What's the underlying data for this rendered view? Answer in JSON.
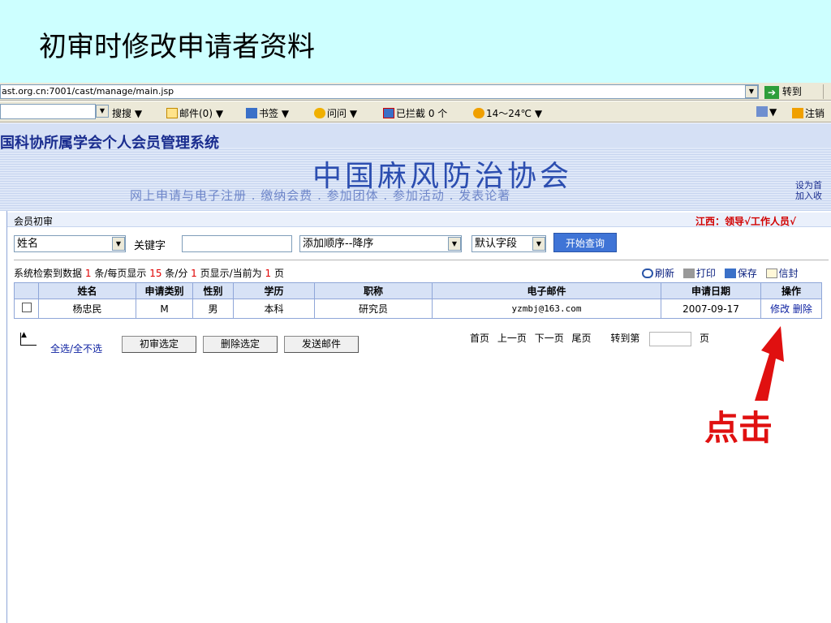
{
  "slide": {
    "title": "初审时修改申请者资料"
  },
  "browser": {
    "address": "ast.org.cn:7001/cast/manage/main.jsp",
    "go_label": "转到",
    "toolbar": {
      "search": "搜搜",
      "mail": "邮件(0)",
      "bookmarks": "书签",
      "ask": "问问",
      "blocked": "已拦截 0 个",
      "weather": "14～24℃",
      "logout": "注销"
    }
  },
  "header": {
    "system_title": "国科协所属学会个人会员管理系统",
    "org_name": "中国麻风防治协会",
    "slogan": "网上申请与电子注册 . 缴纳会费 . 参加团体 . 参加活动 . 发表论著",
    "set_home": "设为首",
    "add_fav": "加入收"
  },
  "section": {
    "title": "会员初审",
    "user_info": "江西：领导√工作人员√"
  },
  "filters": {
    "field": "姓名",
    "keyword_label": "关键字",
    "keyword_value": "",
    "order": "添加顺序--降序",
    "sort_field": "默认字段",
    "query_button": "开始查询"
  },
  "stats": {
    "prefix": "系统检索到数据",
    "count": "1",
    "per_page_label": "条/每页显示",
    "per_page": "15",
    "pages_label": "条/分",
    "pages": "1",
    "current_label": "页显示/当前为",
    "current": "1",
    "suffix": "页"
  },
  "actions": {
    "refresh": "刷新",
    "print": "打印",
    "save": "保存",
    "mail": "信封"
  },
  "table": {
    "headers": [
      "",
      "姓名",
      "申请类别",
      "性别",
      "学历",
      "职称",
      "电子邮件",
      "申请日期",
      "操作"
    ],
    "rows": [
      {
        "name": "杨忠民",
        "category": "M",
        "gender": "男",
        "education": "本科",
        "title": "研究员",
        "email": "yzmbj@163.com",
        "date": "2007-09-17",
        "edit": "修改",
        "delete": "删除"
      }
    ]
  },
  "bottom": {
    "select_all": "全选/全不选",
    "approve_btn": "初审选定",
    "delete_btn": "删除选定",
    "mail_btn": "发送邮件"
  },
  "pager": {
    "first": "首页",
    "prev": "上一页",
    "next": "下一页",
    "last": "尾页",
    "goto": "转到第",
    "page_unit": "页"
  },
  "callout": {
    "text": "点击"
  },
  "colors": {
    "slide_bg": "#cdffff",
    "header_text": "#2c4eb0",
    "accent_red": "#e01010",
    "query_button": "#3f74d6"
  }
}
